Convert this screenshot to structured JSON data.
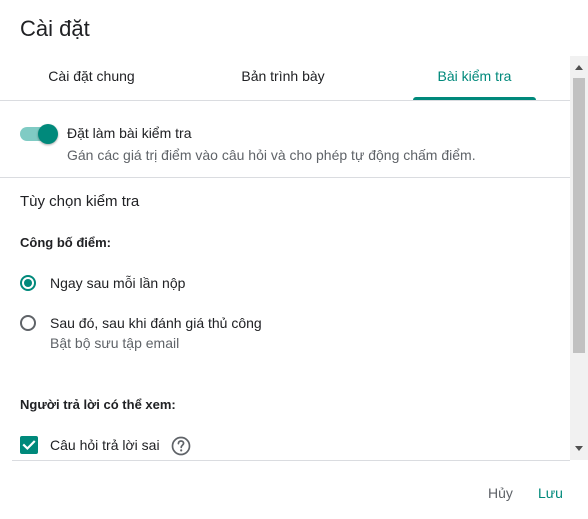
{
  "dialog": {
    "title": "Cài đặt"
  },
  "tabs": [
    {
      "label": "Cài đặt chung",
      "active": false
    },
    {
      "label": "Bản trình bày",
      "active": false
    },
    {
      "label": "Bài kiểm tra",
      "active": true
    }
  ],
  "quiz": {
    "toggle_on": true,
    "label": "Đặt làm bài kiểm tra",
    "description": "Gán các giá trị điểm vào câu hỏi và cho phép tự động chấm điểm."
  },
  "options": {
    "heading": "Tùy chọn kiểm tra",
    "release_grade": {
      "heading": "Công bố điểm:",
      "choices": [
        {
          "label": "Ngay sau mỗi lần nộp",
          "checked": true
        },
        {
          "label": "Sau đó, sau khi đánh giá thủ công",
          "sublabel": "Bật bộ sưu tập email",
          "checked": false
        }
      ]
    },
    "respondent_can_see": {
      "heading": "Người trả lời có thể xem:",
      "items": [
        {
          "label": "Câu hỏi trả lời sai",
          "checked": true,
          "icon": "help-icon"
        }
      ]
    }
  },
  "footer": {
    "cancel_label": "Hủy",
    "save_label": "Lưu"
  },
  "colors": {
    "accent": "#00897b",
    "accent_light": "#80cbc4",
    "text_secondary": "#5f6368"
  }
}
